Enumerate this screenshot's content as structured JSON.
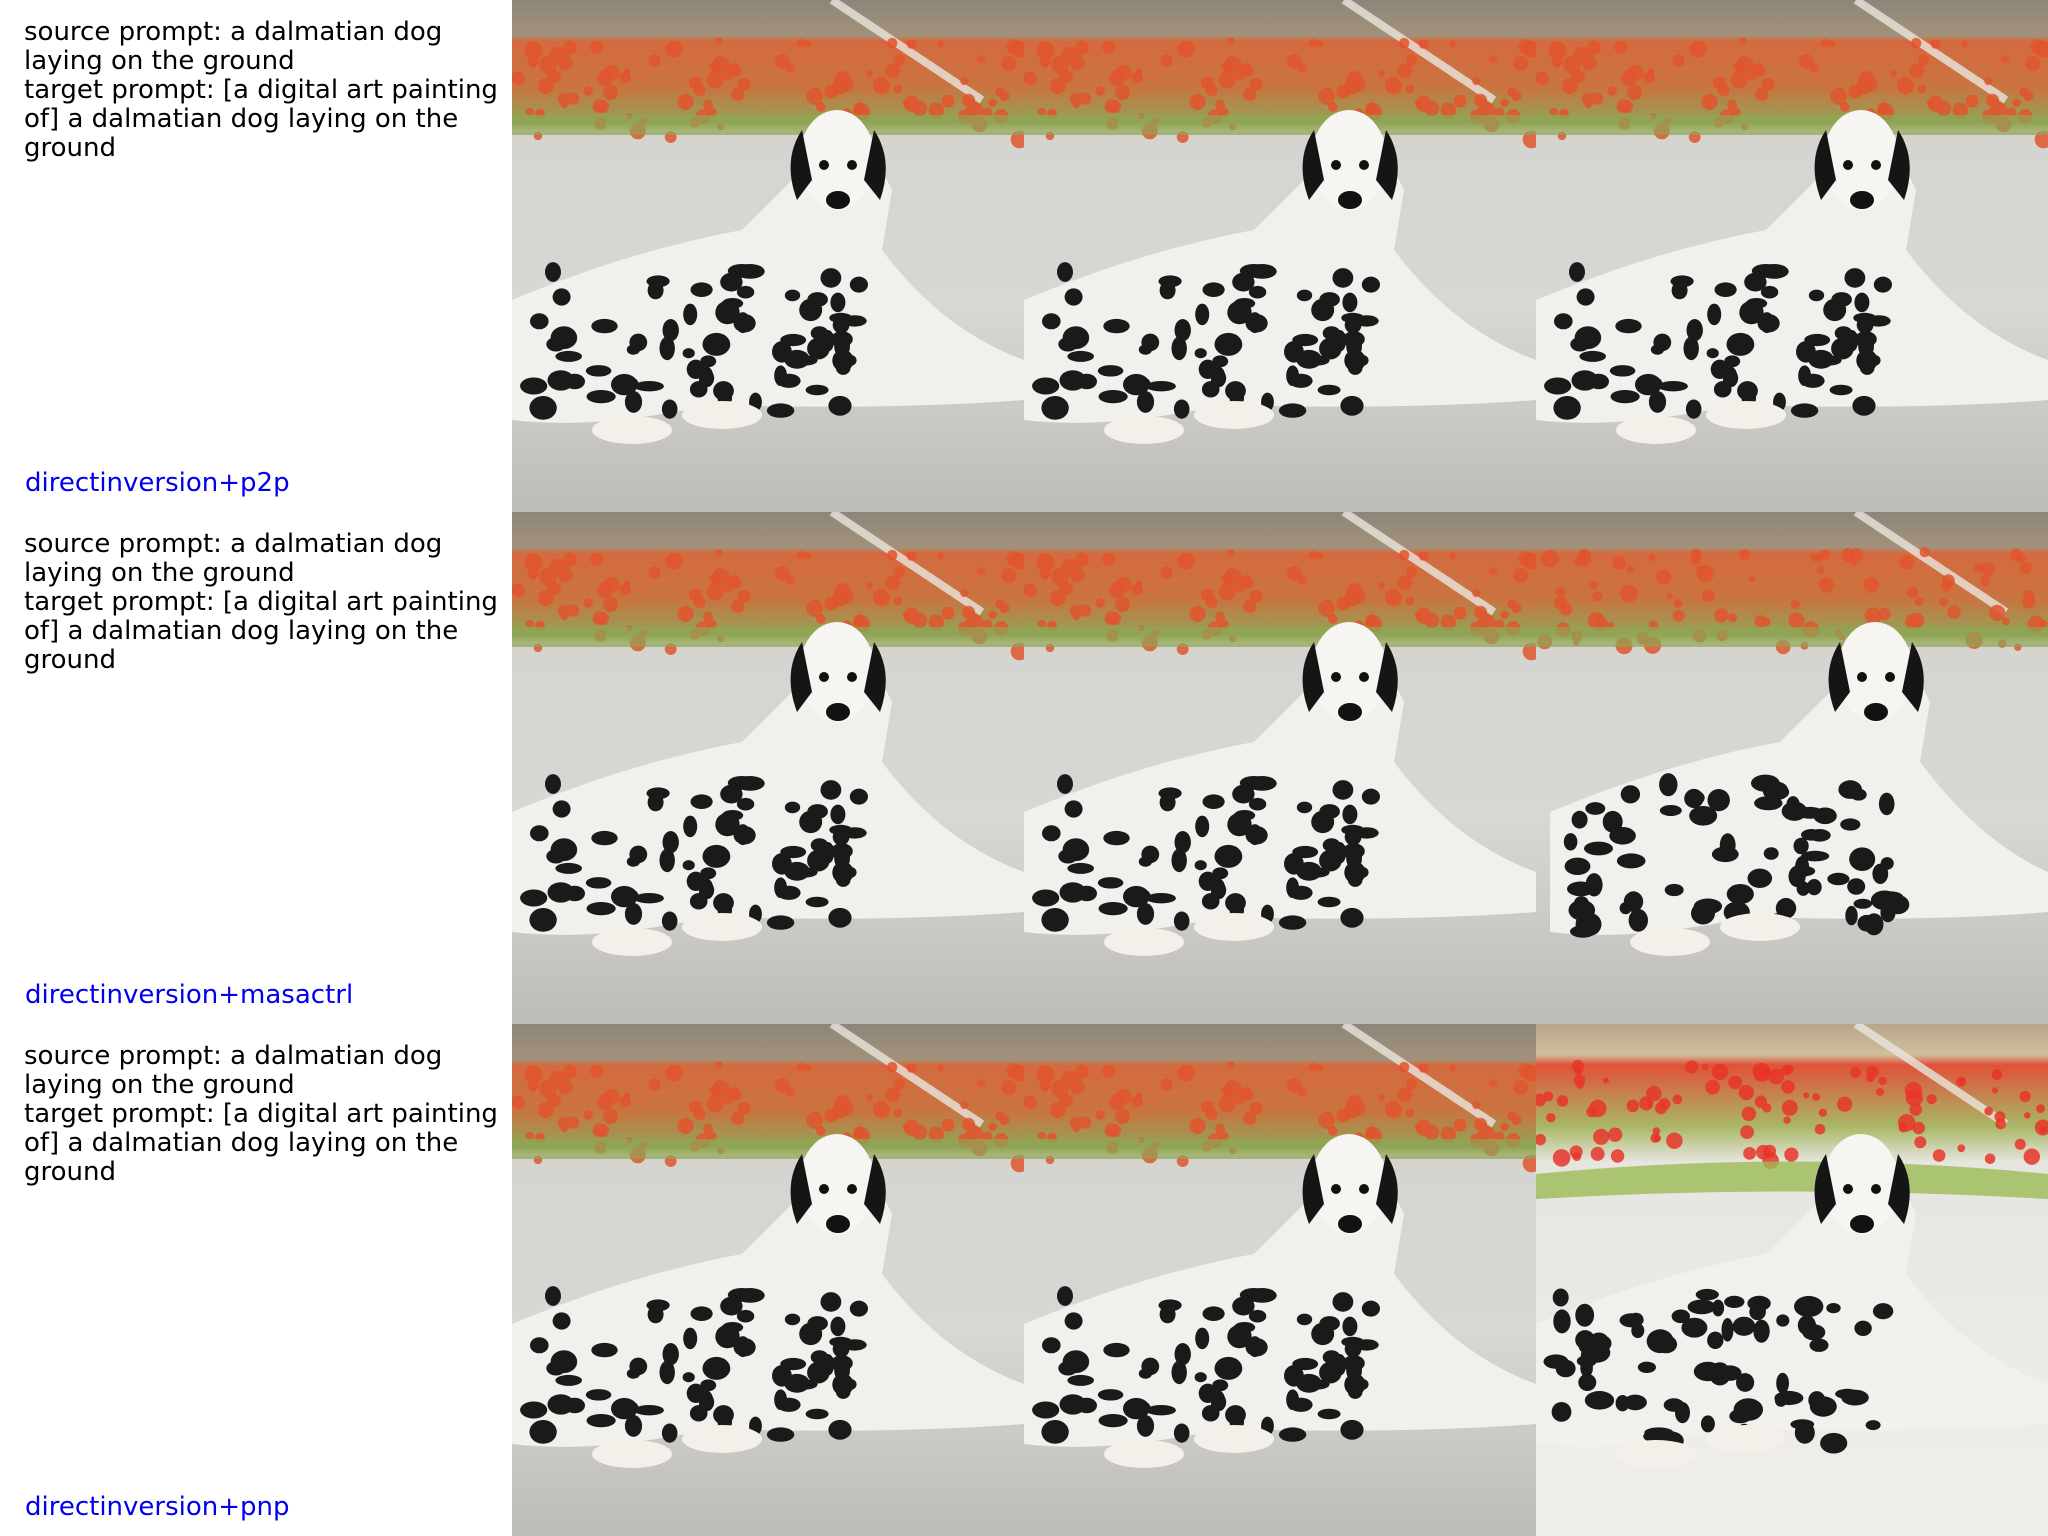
{
  "rows": [
    {
      "source_prompt": "source prompt: a dalmatian dog laying on the ground",
      "target_prompt": "target prompt: [a digital art painting of] a dalmatian dog laying on the ground",
      "method": "directinversion+p2p"
    },
    {
      "source_prompt": "source prompt: a dalmatian dog laying on the ground",
      "target_prompt": "target prompt: [a digital art painting of] a dalmatian dog laying on the ground",
      "method": "directinversion+masactrl"
    },
    {
      "source_prompt": "source prompt: a dalmatian dog laying on the ground",
      "target_prompt": "target prompt: [a digital art painting of] a dalmatian dog laying on the ground",
      "method": "directinversion+pnp"
    }
  ],
  "colors": {
    "method_label": "#0000ee",
    "prompt_text": "#000000"
  }
}
